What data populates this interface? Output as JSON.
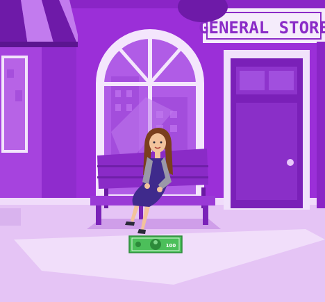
{
  "scene": {
    "store_sign": "GENERAL STORE",
    "banknote_value": "100"
  },
  "colors": {
    "wall": "#9b2fd8",
    "wall_light": "#b65bea",
    "wall_dark": "#7d1fb8",
    "ground": "#e5c4f5",
    "ground_light": "#f1defa",
    "bench": "#8a2bc7",
    "door": "#7a20b8",
    "sign_bg": "#f5ecfb",
    "sign_text": "#8a2bc7",
    "dress": "#3f2a8c",
    "cardigan": "#9a98a8",
    "hair": "#7a3f1e",
    "money": "#4cbf5a"
  }
}
